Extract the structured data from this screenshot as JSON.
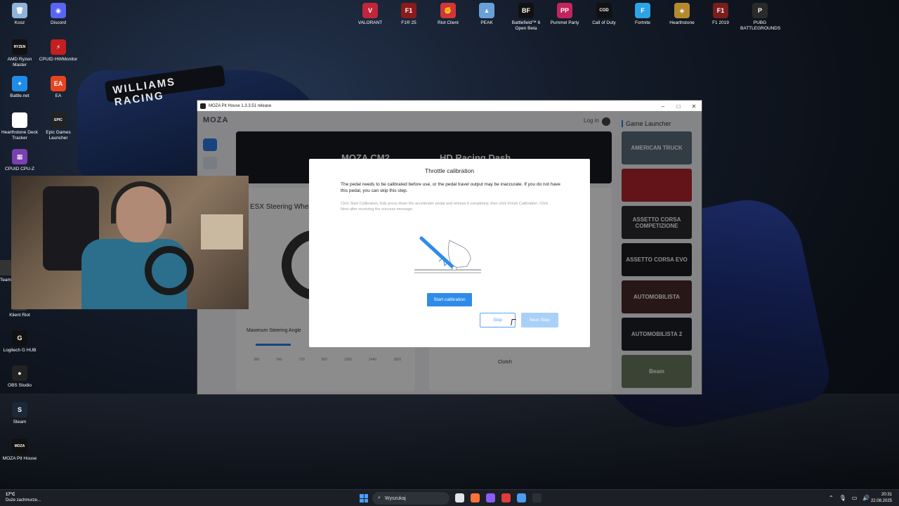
{
  "desktop": {
    "left_icons": [
      {
        "label": "Kosz",
        "color": "#8fb3d9",
        "glyph": "🗑"
      },
      {
        "label": "Discord",
        "color": "#5865f2",
        "glyph": "◉"
      },
      {
        "label": "AMD Ryzen Master",
        "color": "#111111",
        "glyph": "RYZEN"
      },
      {
        "label": "CPUID HWMonitor",
        "color": "#c41f1f",
        "glyph": "⚡"
      },
      {
        "label": "Battle.net",
        "color": "#1f8de8",
        "glyph": "✦"
      },
      {
        "label": "EA",
        "color": "#e8431f",
        "glyph": "EA"
      },
      {
        "label": "Hearthstone Deck Tracker",
        "color": "#ffffff",
        "glyph": "◎"
      },
      {
        "label": "Epic Games Launcher",
        "color": "#222222",
        "glyph": "EPIC"
      },
      {
        "label": "CPUID CPU-Z",
        "color": "#7a3fb0",
        "glyph": "▦"
      },
      {
        "label": "Team",
        "color": "#333333",
        "glyph": ""
      },
      {
        "label": "Klient Riot",
        "color": "#333333",
        "glyph": ""
      },
      {
        "label": "Logitech G HUB",
        "color": "#111111",
        "glyph": "G"
      },
      {
        "label": "OBS Studio",
        "color": "#222222",
        "glyph": "●"
      },
      {
        "label": "Steam",
        "color": "#1b2838",
        "glyph": "S"
      },
      {
        "label": "MOZA Pit House",
        "color": "#111111",
        "glyph": "MOZA"
      }
    ],
    "top_icons": [
      {
        "label": "VALORANT",
        "color": "#c1263b",
        "glyph": "V"
      },
      {
        "label": "F1® 25",
        "color": "#8b1b1b",
        "glyph": "F1"
      },
      {
        "label": "Riot Client",
        "color": "#d13639",
        "glyph": "✊"
      },
      {
        "label": "PEAK",
        "color": "#6aa0d8",
        "glyph": "▲"
      },
      {
        "label": "Battlefield™ 6 Open Beta",
        "color": "#111111",
        "glyph": "BF"
      },
      {
        "label": "Pummel Party",
        "color": "#c2255c",
        "glyph": "PP"
      },
      {
        "label": "Call of Duty",
        "color": "#111111",
        "glyph": "COD"
      },
      {
        "label": "Fortnite",
        "color": "#2ea3e6",
        "glyph": "F"
      },
      {
        "label": "Hearthstone",
        "color": "#b58a2e",
        "glyph": "◈"
      },
      {
        "label": "F1 2019",
        "color": "#7a1d1d",
        "glyph": "F1"
      },
      {
        "label": "PUBG BATTLEGROUNDS",
        "color": "#2a2a2a",
        "glyph": "P"
      }
    ],
    "wallpaper_wing_text": "WILLIAMS RACING"
  },
  "window": {
    "title": "MOZA Pit House 1.3.3.51 release",
    "controls": [
      "–",
      "□",
      "✕"
    ],
    "logo": "MOZA",
    "login_label": "Log in",
    "banner_left": "MOZA CM2",
    "banner_right": "HD Racing Dash",
    "wheel_title": "ESX Steering Whee",
    "max_angle_label": "Maximum Steering Angle",
    "angle_ticks": [
      "360",
      "540",
      "720",
      "900",
      "1080",
      "1440",
      "1800"
    ],
    "clutch_label": "Clutch",
    "launcher_title": "Game Launcher",
    "games": [
      {
        "name": "AMERICAN TRUCK",
        "color": "#5b6e7c"
      },
      {
        "name": "",
        "color": "#b3262d"
      },
      {
        "name": "ASSETTO CORSA COMPETIZIONE",
        "color": "#2a2a2e"
      },
      {
        "name": "ASSETTO CORSA EVO",
        "color": "#1c1c22"
      },
      {
        "name": "AUTOMOBILISTA",
        "color": "#4a2a2a"
      },
      {
        "name": "AUTOMOBILISTA 2",
        "color": "#1e1f26"
      },
      {
        "name": "Beam",
        "color": "#6b7a60"
      }
    ]
  },
  "modal": {
    "title": "Throttle calibration",
    "paragraph": "The pedal needs to be calibrated before use, or the pedal travel output may be inaccurate. If you do not have this pedal, you can skip this step.",
    "hint": "Click Start Calibration, fully press down the accelerator pedal and release it completely, then click Finish Calibration. Click Next after receiving the success message.",
    "start_label": "Start calibration",
    "skip_label": "Skip",
    "next_label": "Next Step"
  },
  "taskbar": {
    "weather_temp": "17°C",
    "weather_desc": "Duże zachmurze...",
    "search_placeholder": "Wyszukaj",
    "time": "20:31",
    "date": "22.08.2025",
    "app_colors": [
      "#e0e4ea",
      "#ff7139",
      "#8a5cf5",
      "#e23b3b",
      "#4a9cf0",
      "#2b2f38"
    ]
  }
}
